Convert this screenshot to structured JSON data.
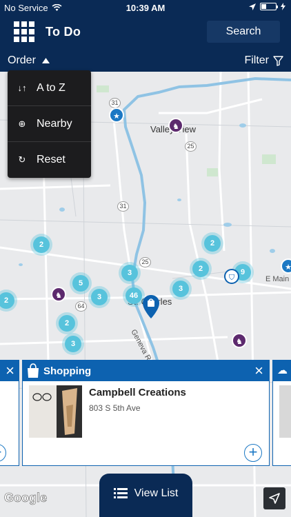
{
  "status": {
    "carrier": "No Service",
    "time": "10:39 AM"
  },
  "header": {
    "title": "To Do",
    "search_label": "Search"
  },
  "toolbar": {
    "order_label": "Order",
    "filter_label": "Filter"
  },
  "sort_menu": {
    "items": [
      {
        "label": "A to Z",
        "icon": "sort-az-icon"
      },
      {
        "label": "Nearby",
        "icon": "crosshair-icon"
      },
      {
        "label": "Reset",
        "icon": "reset-icon"
      }
    ]
  },
  "map": {
    "labels": {
      "town1": "Valley View",
      "town2": "St. Charles",
      "road": "Geneva Rd",
      "street": "E Main St"
    },
    "route_shields": [
      "31",
      "25",
      "25",
      "31",
      "64"
    ],
    "clusters": [
      "2",
      "2",
      "2",
      "9",
      "5",
      "3",
      "46",
      "3",
      "3",
      "2",
      "2",
      "3"
    ]
  },
  "card": {
    "category": "Shopping",
    "name": "Campbell Creations",
    "address": "803 S 5th Ave",
    "image_text": "Campbell Creations"
  },
  "view_list_label": "View List",
  "attribution": "Google",
  "colors": {
    "navy": "#0a2a55",
    "accent": "#0d62b0",
    "cluster": "#57c3dc",
    "poi_purple": "#5d2a6e"
  }
}
